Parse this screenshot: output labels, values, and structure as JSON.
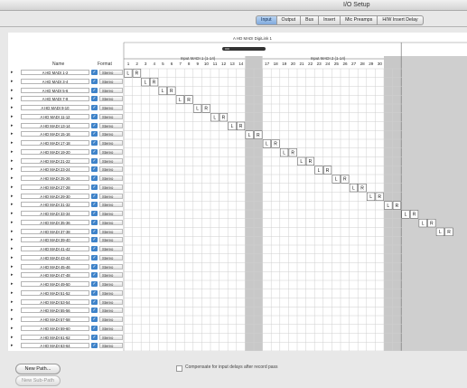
{
  "window": {
    "title": "I/O Setup"
  },
  "tabs": [
    "Input",
    "Output",
    "Bus",
    "Insert",
    "Mic Preamps",
    "H/W Insert Delay"
  ],
  "active_tab": "Input",
  "interface": {
    "label": "A HD MADI DigiLink 1"
  },
  "groups": [
    {
      "label": "Input MADI 1 (1-14)"
    },
    {
      "label": "Input MADI 2 (1-14)"
    }
  ],
  "columns": {
    "name": "Name",
    "format": "Format"
  },
  "channel_numbers": [
    "1",
    "2",
    "3",
    "4",
    "5",
    "6",
    "7",
    "8",
    "9",
    "10",
    "11",
    "12",
    "13",
    "14",
    "15",
    "16",
    "17",
    "18",
    "19",
    "20",
    "21",
    "22",
    "23",
    "24",
    "25",
    "26",
    "27",
    "28",
    "29",
    "30",
    "31",
    "32",
    "33",
    "34",
    "35",
    "36",
    "37",
    "38",
    "39",
    "4"
  ],
  "paths": [
    {
      "name": "A HD MADI 1-2",
      "format": "Stereo",
      "assign": [
        "L",
        "R"
      ]
    },
    {
      "name": "A HD MADI 3-4",
      "format": "Stereo",
      "assign": [
        "L",
        "R"
      ]
    },
    {
      "name": "A HD MADI 5-6",
      "format": "Stereo",
      "assign": [
        "L",
        "R"
      ]
    },
    {
      "name": "A HD MADI 7-8",
      "format": "Stereo",
      "assign": [
        "L",
        "R"
      ]
    },
    {
      "name": "A HD MADI 9-10",
      "format": "Stereo",
      "assign": [
        "L",
        "R"
      ]
    },
    {
      "name": "A HD MADI 11-12",
      "format": "Stereo",
      "assign": [
        "L",
        "R"
      ]
    },
    {
      "name": "A HD MADI 13-14",
      "format": "Stereo",
      "assign": [
        "L",
        "R"
      ]
    },
    {
      "name": "A HD MADI 15-16",
      "format": "Stereo",
      "assign": [
        "L",
        "R"
      ]
    },
    {
      "name": "A HD MADI 17-18",
      "format": "Stereo",
      "assign": [
        "L",
        "R"
      ]
    },
    {
      "name": "A HD MADI 19-20",
      "format": "Stereo",
      "assign": [
        "L",
        "R"
      ]
    },
    {
      "name": "A HD MADI 21-22",
      "format": "Stereo",
      "assign": [
        "L",
        "R"
      ]
    },
    {
      "name": "A HD MADI 23-24",
      "format": "Stereo",
      "assign": [
        "L",
        "R"
      ]
    },
    {
      "name": "A HD MADI 25-26",
      "format": "Stereo",
      "assign": [
        "L",
        "R"
      ]
    },
    {
      "name": "A HD MADI 27-28",
      "format": "Stereo",
      "assign": [
        "L",
        "R"
      ]
    },
    {
      "name": "A HD MADI 29-30",
      "format": "Stereo",
      "assign": [
        "L",
        "R"
      ]
    },
    {
      "name": "A HD MADI 31-32",
      "format": "Stereo",
      "assign": [
        "L",
        "R"
      ]
    },
    {
      "name": "A HD MADI 33-34",
      "format": "Stereo",
      "assign": [
        "L",
        "R"
      ]
    },
    {
      "name": "A HD MADI 35-36",
      "format": "Stereo",
      "assign": [
        "L",
        "R"
      ]
    },
    {
      "name": "A HD MADI 37-38",
      "format": "Stereo",
      "assign": [
        "L",
        "R"
      ]
    },
    {
      "name": "A HD MADI 39-40",
      "format": "Stereo",
      "assign": []
    },
    {
      "name": "A HD MADI 41-42",
      "format": "Stereo",
      "assign": []
    },
    {
      "name": "A HD MADI 43-44",
      "format": "Stereo",
      "assign": []
    },
    {
      "name": "A HD MADI 45-46",
      "format": "Stereo",
      "assign": []
    },
    {
      "name": "A HD MADI 47-48",
      "format": "Stereo",
      "assign": []
    },
    {
      "name": "A HD MADI 49-50",
      "format": "Stereo",
      "assign": []
    },
    {
      "name": "A HD MADI 51-52",
      "format": "Stereo",
      "assign": []
    },
    {
      "name": "A HD MADI 53-54",
      "format": "Stereo",
      "assign": []
    },
    {
      "name": "A HD MADI 55-56",
      "format": "Stereo",
      "assign": []
    },
    {
      "name": "A HD MADI 57-58",
      "format": "Stereo",
      "assign": []
    },
    {
      "name": "A HD MADI 59-60",
      "format": "Stereo",
      "assign": []
    },
    {
      "name": "A HD MADI 61-62",
      "format": "Stereo",
      "assign": []
    },
    {
      "name": "A HD MADI 63-64",
      "format": "Stereo",
      "assign": []
    }
  ],
  "buttons": {
    "new_path": "New Path...",
    "new_sub_path": "New Sub-Path"
  },
  "compensate": {
    "label": "Compensate for input delays after record pass",
    "checked": false
  },
  "icons": {
    "path_arrow": "disclosure-triangle-icon",
    "format_check": "checkmark-icon"
  },
  "colors": {
    "active_tab": "#8fb4e3",
    "checkbox": "#3f83c9",
    "shaded_column": "#c8c8c8",
    "grid_line": "#cfcfcf"
  }
}
